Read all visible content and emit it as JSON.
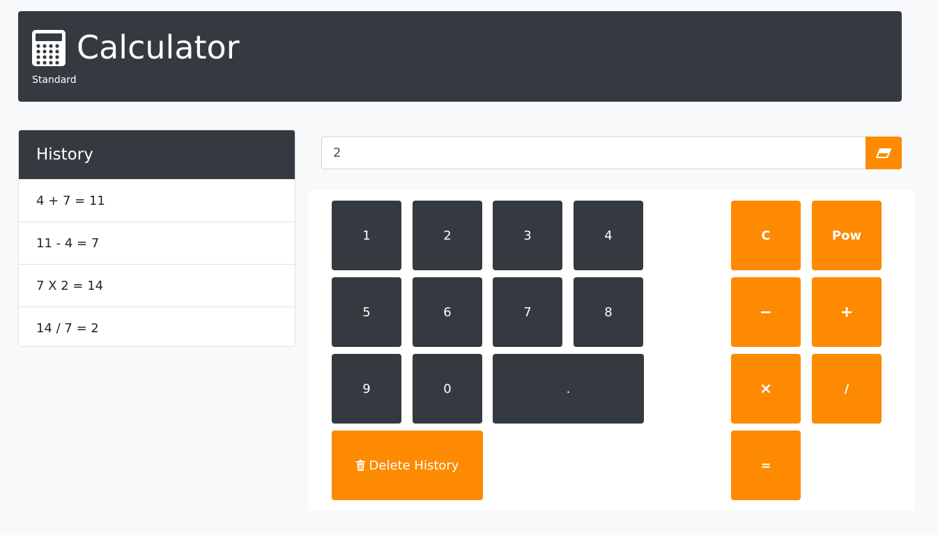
{
  "header": {
    "title": "Calculator",
    "subtitle": "Standard",
    "icon": "calculator-icon"
  },
  "history": {
    "title": "History",
    "items": [
      "4 + 7 = 11",
      "11 - 4 = 7",
      "7 X 2 = 14",
      "14 / 7 = 2"
    ]
  },
  "display": {
    "value": "2",
    "clear_icon": "eraser-icon"
  },
  "keys": {
    "digits": [
      "1",
      "2",
      "3",
      "4",
      "5",
      "6",
      "7",
      "8",
      "9",
      "0",
      "."
    ],
    "clear": "C",
    "pow": "Pow",
    "minus": "−",
    "plus": "+",
    "times": "×",
    "divide": "/",
    "equals": "=",
    "delete_history": "Delete History"
  },
  "colors": {
    "dark": "#343a40",
    "accent": "#fd8a00",
    "background": "#f8f9fa"
  }
}
